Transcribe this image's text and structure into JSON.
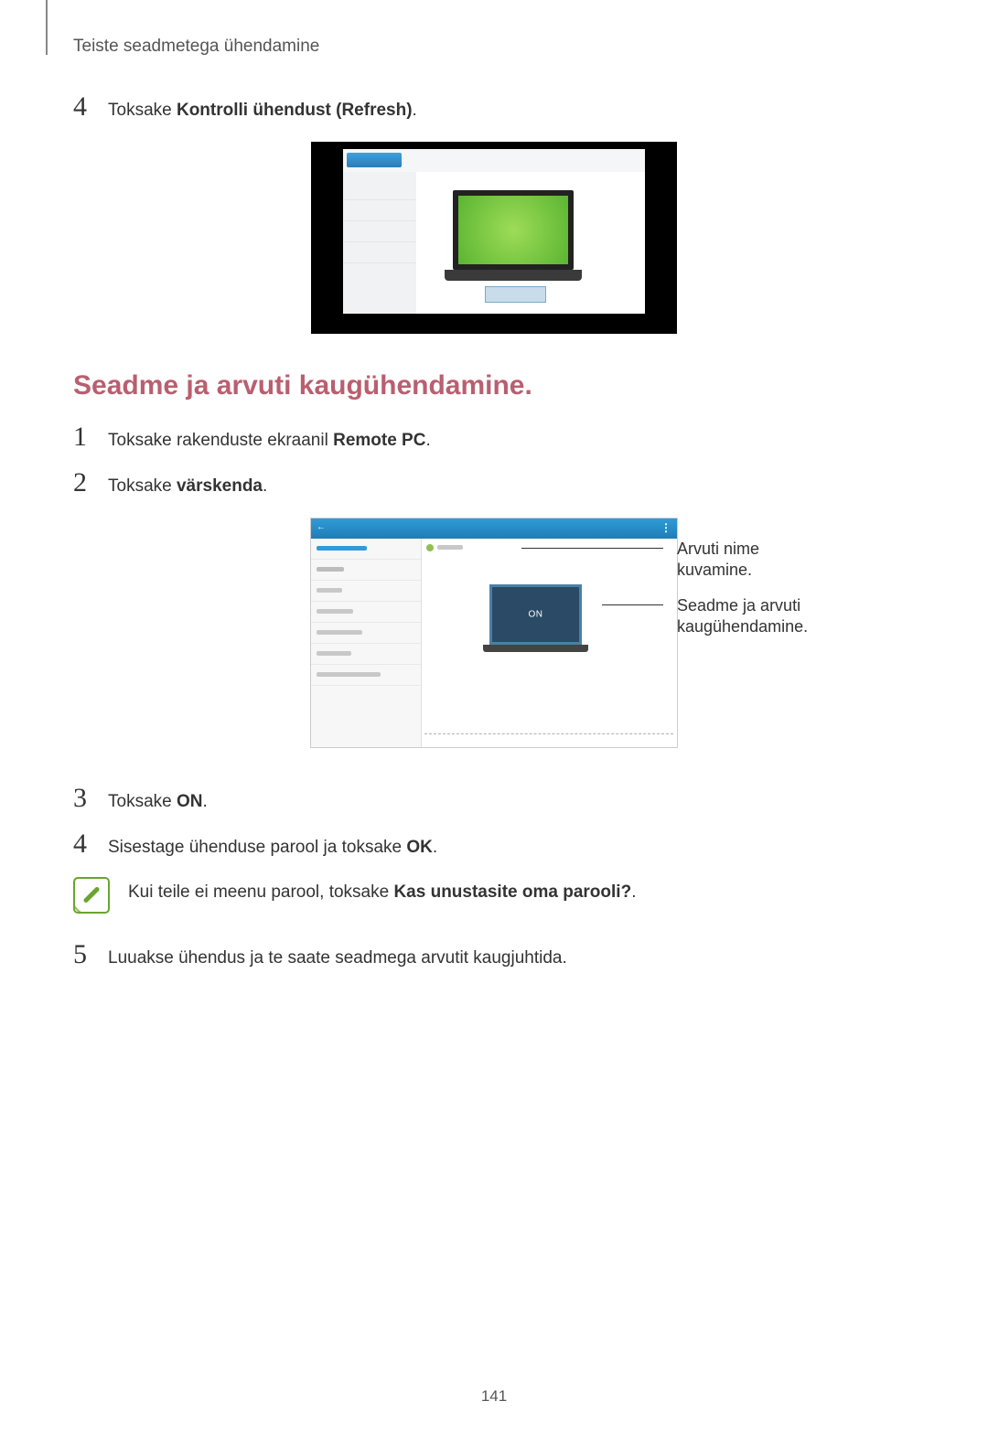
{
  "header": "Teiste seadmetega ühendamine",
  "top_step": {
    "num": "4",
    "pre": "Toksake ",
    "bold": "Kontrolli ühendust (Refresh)",
    "post": "."
  },
  "section_title": "Seadme ja arvuti kaugühendamine.",
  "steps_a": [
    {
      "num": "1",
      "pre": "Toksake rakenduste ekraanil ",
      "bold": "Remote PC",
      "post": "."
    },
    {
      "num": "2",
      "pre": "Toksake ",
      "bold": "värskenda",
      "post": "."
    }
  ],
  "fig2": {
    "on_text": "ON"
  },
  "callouts": {
    "top": "Arvuti nime kuvamine.",
    "mid": "Seadme ja arvuti kaugühendamine."
  },
  "steps_b": [
    {
      "num": "3",
      "pre": "Toksake ",
      "bold": "ON",
      "post": "."
    },
    {
      "num": "4",
      "pre": "Sisestage ühenduse parool ja toksake ",
      "bold": "OK",
      "post": "."
    }
  ],
  "note": {
    "pre": "Kui teile ei meenu parool, toksake ",
    "bold": "Kas unustasite oma parooli?",
    "post": "."
  },
  "step_last": {
    "num": "5",
    "text": "Luuakse ühendus ja te saate seadmega arvutit kaugjuhtida."
  },
  "page_number": "141"
}
